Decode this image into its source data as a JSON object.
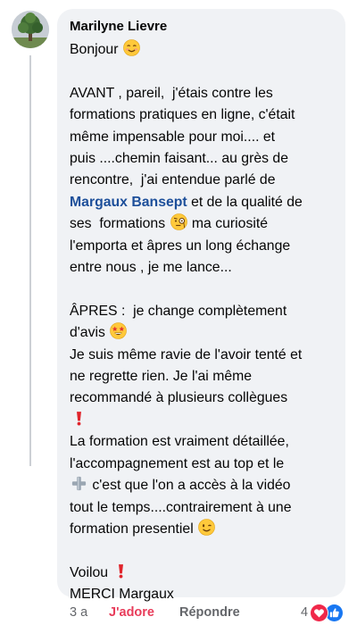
{
  "comment": {
    "author": "Marilyne Lievre",
    "paragraphs": [
      {
        "lines": [
          {
            "parts": [
              {
                "t": "Bonjour "
              },
              {
                "emoji": "smiling-face-emoji"
              }
            ]
          }
        ]
      },
      {
        "lines": [
          {
            "parts": [
              {
                "t": "AVANT , pareil,  j'étais contre les"
              }
            ]
          },
          {
            "parts": [
              {
                "t": "formations pratiques en ligne, c'était"
              }
            ]
          },
          {
            "parts": [
              {
                "t": "même impensable pour moi.... et"
              }
            ]
          },
          {
            "parts": [
              {
                "t": "puis ....chemin faisant... au grès de"
              }
            ]
          },
          {
            "parts": [
              {
                "t": "rencontre,  j'ai entendue parlé de"
              }
            ]
          },
          {
            "parts": [
              {
                "mention": "Margaux Bansept"
              },
              {
                "t": " et de la qualité de"
              }
            ]
          },
          {
            "parts": [
              {
                "t": "ses  formations "
              },
              {
                "emoji": "monocle-face-emoji"
              },
              {
                "t": " ma curiosité"
              }
            ]
          },
          {
            "parts": [
              {
                "t": "l'emporta et âpres un long échange"
              }
            ]
          },
          {
            "parts": [
              {
                "t": "entre nous , je me lance..."
              }
            ]
          }
        ]
      },
      {
        "lines": [
          {
            "parts": [
              {
                "t": "ÂPRES :  je change complètement"
              }
            ]
          },
          {
            "parts": [
              {
                "t": "d'avis "
              },
              {
                "emoji": "star-struck-emoji"
              }
            ]
          },
          {
            "parts": [
              {
                "t": "Je suis même ravie de l'avoir tenté et"
              }
            ]
          },
          {
            "parts": [
              {
                "t": "ne regrette rien. Je l'ai même"
              }
            ]
          },
          {
            "parts": [
              {
                "t": "recommandé à plusieurs collègues"
              }
            ]
          },
          {
            "parts": [
              {
                "emoji": "exclamation-emoji"
              }
            ]
          },
          {
            "parts": [
              {
                "t": "La formation est vraiment détaillée,"
              }
            ]
          },
          {
            "parts": [
              {
                "t": "l'accompagnement est au top et le"
              }
            ]
          },
          {
            "parts": [
              {
                "emoji": "plus-emoji"
              },
              {
                "t": " c'est que l'on a accès à la vidéo"
              }
            ]
          },
          {
            "parts": [
              {
                "t": "tout le temps....contrairement à une"
              }
            ]
          },
          {
            "parts": [
              {
                "t": "formation presentiel "
              },
              {
                "emoji": "winking-face-emoji"
              }
            ]
          }
        ]
      },
      {
        "lines": [
          {
            "parts": [
              {
                "t": "Voilou "
              },
              {
                "emoji": "exclamation-emoji"
              }
            ]
          },
          {
            "parts": [
              {
                "t": "MERCI Margaux"
              }
            ]
          }
        ]
      }
    ]
  },
  "footer": {
    "time": "3 a",
    "reaction_label": "J'adore",
    "reply_label": "Répondre",
    "reaction_count": "4",
    "reaction_icons": [
      "heart-reaction-icon",
      "like-reaction-icon"
    ]
  },
  "colors": {
    "bubble_background": "#f0f2f5",
    "mention": "#1d4f9a",
    "love": "#e83c5a",
    "secondary_text": "#65676b",
    "like_blue": "#1877f2"
  }
}
